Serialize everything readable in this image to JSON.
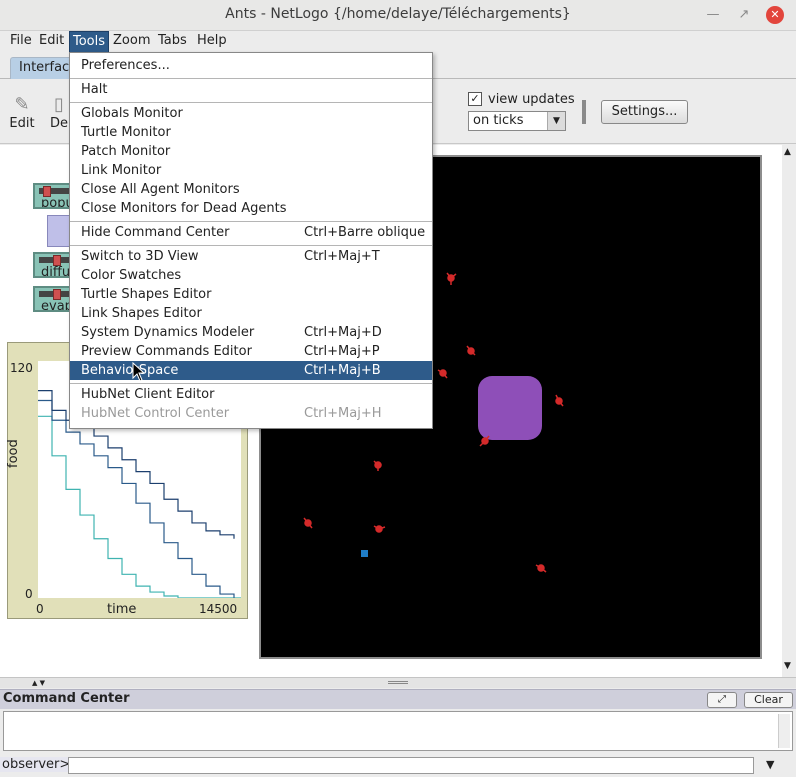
{
  "window": {
    "title": "Ants - NetLogo {/home/delaye/Téléchargements}"
  },
  "menubar": {
    "items": [
      "File",
      "Edit",
      "Tools",
      "Zoom",
      "Tabs",
      "Help"
    ]
  },
  "tabs": {
    "interface": "Interface"
  },
  "toolbar": {
    "edit_label": "Edit",
    "delete_label_partial": "De",
    "view_updates_label": "view updates",
    "view_updates_checked": true,
    "update_mode": "on ticks",
    "settings_label": "Settings..."
  },
  "sliders": [
    {
      "label_partial": "popu"
    },
    {
      "label_partial": "diffu"
    },
    {
      "label_partial": "evap"
    }
  ],
  "plot": {
    "ylabel": "food",
    "xlabel": "time",
    "ymax_label": "120",
    "ymin_label": "0",
    "xmin_label": "0",
    "xmax_label": "14500"
  },
  "chart_data": {
    "type": "line",
    "title": "",
    "xlabel": "time",
    "ylabel": "food",
    "xlim": [
      0,
      14500
    ],
    "ylim": [
      0,
      120
    ],
    "series": [
      {
        "color": "#3fb3b0",
        "x": [
          0,
          1000,
          2000,
          3000,
          4000,
          5000,
          6000,
          7000,
          8000,
          9000,
          10000,
          14500
        ],
        "y": [
          92,
          72,
          55,
          42,
          30,
          20,
          12,
          6,
          3,
          1,
          0,
          0
        ]
      },
      {
        "color": "#2a5a8a",
        "x": [
          0,
          1000,
          2000,
          3000,
          4000,
          5000,
          6000,
          7000,
          8000,
          9000,
          10000,
          11000,
          12000,
          13000,
          14000
        ],
        "y": [
          100,
          90,
          84,
          78,
          72,
          66,
          58,
          48,
          38,
          28,
          20,
          12,
          6,
          2,
          0
        ]
      },
      {
        "color": "#1c3f6e",
        "x": [
          0,
          1000,
          2000,
          3000,
          4000,
          5000,
          6000,
          7000,
          8000,
          9000,
          10000,
          11000,
          12000,
          13000,
          14000
        ],
        "y": [
          105,
          95,
          90,
          86,
          82,
          76,
          70,
          64,
          58,
          50,
          44,
          38,
          34,
          32,
          30
        ]
      }
    ]
  },
  "world": {
    "background": "#000000",
    "nest_color": "#8e4fb8",
    "food_color": "#1f7dc7",
    "ant_color": "#d42a2a"
  },
  "tools_menu": {
    "items": [
      {
        "label": "Preferences...",
        "shortcut": ""
      },
      {
        "label": "Halt",
        "shortcut": ""
      },
      {
        "label": "Globals Monitor",
        "shortcut": ""
      },
      {
        "label": "Turtle Monitor",
        "shortcut": ""
      },
      {
        "label": "Patch Monitor",
        "shortcut": ""
      },
      {
        "label": "Link Monitor",
        "shortcut": ""
      },
      {
        "label": "Close All Agent Monitors",
        "shortcut": ""
      },
      {
        "label": "Close Monitors for Dead Agents",
        "shortcut": ""
      },
      {
        "label": "Hide Command Center",
        "shortcut": "Ctrl+Barre oblique"
      },
      {
        "label": "Switch to 3D View",
        "shortcut": "Ctrl+Maj+T"
      },
      {
        "label": "Color Swatches",
        "shortcut": ""
      },
      {
        "label": "Turtle Shapes Editor",
        "shortcut": ""
      },
      {
        "label": "Link Shapes Editor",
        "shortcut": ""
      },
      {
        "label": "System Dynamics Modeler",
        "shortcut": "Ctrl+Maj+D"
      },
      {
        "label": "Preview Commands Editor",
        "shortcut": "Ctrl+Maj+P"
      },
      {
        "label": "BehaviorSpace",
        "shortcut": "Ctrl+Maj+B"
      },
      {
        "label": "HubNet Client Editor",
        "shortcut": ""
      },
      {
        "label": "HubNet Control Center",
        "shortcut": "Ctrl+Maj+H"
      }
    ]
  },
  "command_center": {
    "title": "Command Center",
    "clear_label": "Clear",
    "prompt": "observer>"
  },
  "icons": [
    "pencil-icon",
    "minimize-icon",
    "maximize-icon",
    "close-icon",
    "chevron-down-icon",
    "expand-icon",
    "cursor-icon"
  ]
}
